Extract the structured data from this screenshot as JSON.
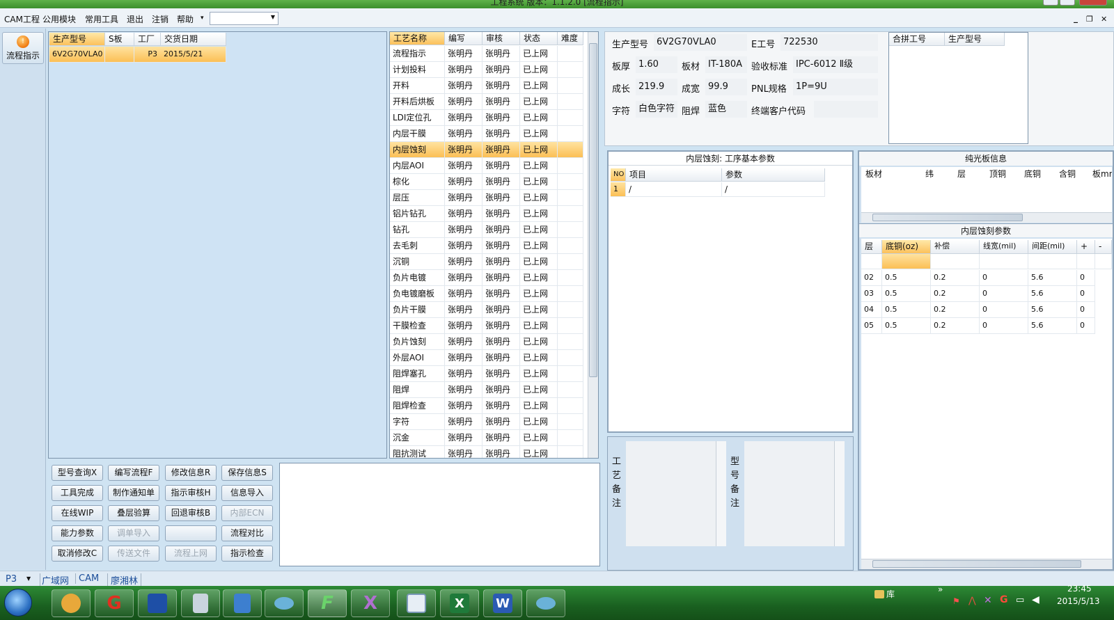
{
  "window": {
    "title": "工程系统   版本：1.1.2.0  [流程指示]"
  },
  "menu": {
    "items": [
      "CAM工程",
      "公用模块",
      "常用工具",
      "退出",
      "注销",
      "帮助"
    ],
    "help_arrow": "▾",
    "combo_value": ""
  },
  "mdi_controls": {
    "min": "_",
    "restore": "❐",
    "close": "✕"
  },
  "side": {
    "flow_button": "流程指示"
  },
  "product_grid": {
    "headers": [
      "生产型号",
      "S板",
      "工厂",
      "交货日期"
    ],
    "rows": [
      [
        "6V2G70VLA0",
        "",
        "P3",
        "2015/5/21"
      ]
    ]
  },
  "process_grid": {
    "headers": [
      "工艺名称",
      "编写",
      "审核",
      "状态",
      "难度"
    ],
    "rows": [
      [
        "流程指示",
        "张明丹",
        "张明丹",
        "已上网",
        ""
      ],
      [
        "计划投料",
        "张明丹",
        "张明丹",
        "已上网",
        ""
      ],
      [
        "开料",
        "张明丹",
        "张明丹",
        "已上网",
        ""
      ],
      [
        "开料后烘板",
        "张明丹",
        "张明丹",
        "已上网",
        ""
      ],
      [
        "LDI定位孔",
        "张明丹",
        "张明丹",
        "已上网",
        ""
      ],
      [
        "内层干膜",
        "张明丹",
        "张明丹",
        "已上网",
        ""
      ],
      [
        "内层蚀刻",
        "张明丹",
        "张明丹",
        "已上网",
        ""
      ],
      [
        "内层AOI",
        "张明丹",
        "张明丹",
        "已上网",
        ""
      ],
      [
        "棕化",
        "张明丹",
        "张明丹",
        "已上网",
        ""
      ],
      [
        "层压",
        "张明丹",
        "张明丹",
        "已上网",
        ""
      ],
      [
        "铝片钻孔",
        "张明丹",
        "张明丹",
        "已上网",
        ""
      ],
      [
        "钻孔",
        "张明丹",
        "张明丹",
        "已上网",
        ""
      ],
      [
        "去毛刺",
        "张明丹",
        "张明丹",
        "已上网",
        ""
      ],
      [
        "沉铜",
        "张明丹",
        "张明丹",
        "已上网",
        ""
      ],
      [
        "负片电镀",
        "张明丹",
        "张明丹",
        "已上网",
        ""
      ],
      [
        "负电镀磨板",
        "张明丹",
        "张明丹",
        "已上网",
        ""
      ],
      [
        "负片干膜",
        "张明丹",
        "张明丹",
        "已上网",
        ""
      ],
      [
        "干膜检查",
        "张明丹",
        "张明丹",
        "已上网",
        ""
      ],
      [
        "负片蚀刻",
        "张明丹",
        "张明丹",
        "已上网",
        ""
      ],
      [
        "外层AOI",
        "张明丹",
        "张明丹",
        "已上网",
        ""
      ],
      [
        "阻焊塞孔",
        "张明丹",
        "张明丹",
        "已上网",
        ""
      ],
      [
        "阻焊",
        "张明丹",
        "张明丹",
        "已上网",
        ""
      ],
      [
        "阻焊检查",
        "张明丹",
        "张明丹",
        "已上网",
        ""
      ],
      [
        "字符",
        "张明丹",
        "张明丹",
        "已上网",
        ""
      ],
      [
        "沉金",
        "张明丹",
        "张明丹",
        "已上网",
        ""
      ],
      [
        "阻抗测试",
        "张明丹",
        "张明丹",
        "已上网",
        ""
      ]
    ],
    "selected_row": 6
  },
  "buttons": [
    [
      "型号查询X",
      "编写流程F",
      "修改信息R",
      "保存信息S"
    ],
    [
      "工具完成",
      "制作通知单",
      "指示审核H",
      "信息导入"
    ],
    [
      "在线WIP",
      "叠层验算",
      "回退审核B",
      "内部ECN"
    ],
    [
      "能力参数",
      "调单导入",
      "",
      "流程对比"
    ],
    [
      "取消修改C",
      "传送文件",
      "流程上网",
      "指示检查"
    ]
  ],
  "disabled_buttons": [
    "内部ECN",
    "调单导入",
    "传送文件",
    "流程上网"
  ],
  "info": {
    "model_label": "生产型号",
    "model_value": "6V2G70VLA0",
    "eno_label": "E工号",
    "eno_value": "722530",
    "thickness_label": "板厚",
    "thickness_value": "1.60",
    "material_label": "板材",
    "material_value": "IT-180A",
    "standard_label": "验收标准",
    "standard_value": "IPC-6012 Ⅱ级",
    "length_label": "成长",
    "length_value": "219.9",
    "width_label": "成宽",
    "width_value": "99.9",
    "pnl_label": "PNL规格",
    "pnl_value": "1P=9U",
    "char_label": "字符",
    "char_value": "白色字符",
    "mask_label": "阻焊",
    "mask_value": "蓝色",
    "endcode_label": "终端客户代码",
    "endcode_value": ""
  },
  "combine_grid": {
    "headers": [
      "合拼工号",
      "生产型号"
    ]
  },
  "step_params": {
    "title": "内层蚀刻: 工序基本参数",
    "headers": [
      "NO",
      "项目",
      "参数"
    ],
    "rows": [
      [
        "1",
        "/",
        "/"
      ]
    ]
  },
  "optical": {
    "title": "纯光板信息",
    "headers": [
      "板材",
      "纬",
      "层",
      "顶铜",
      "底铜",
      "含铜",
      "板mm"
    ]
  },
  "etch": {
    "title": "内层蚀刻参数",
    "headers": [
      "层",
      "底铜(oz)",
      "补偿",
      "线宽(mil)",
      "间距(mil)",
      "+",
      "-"
    ],
    "rows": [
      [
        "02",
        "0.5",
        "0.2",
        "0",
        "5.6",
        "0"
      ],
      [
        "03",
        "0.5",
        "0.2",
        "0",
        "5.6",
        "0"
      ],
      [
        "04",
        "0.5",
        "0.2",
        "0",
        "5.6",
        "0"
      ],
      [
        "05",
        "0.5",
        "0.2",
        "0",
        "5.6",
        "0"
      ]
    ]
  },
  "notes": {
    "process_label": "工艺备注",
    "model_label": "型号备注"
  },
  "status": {
    "factory": "P3",
    "tabs": [
      "广域网",
      "CAM",
      "廖湘林"
    ]
  },
  "taskbar": {
    "tray_label": "库",
    "time": "23:45",
    "date": "2015/5/13",
    "more": "»"
  }
}
